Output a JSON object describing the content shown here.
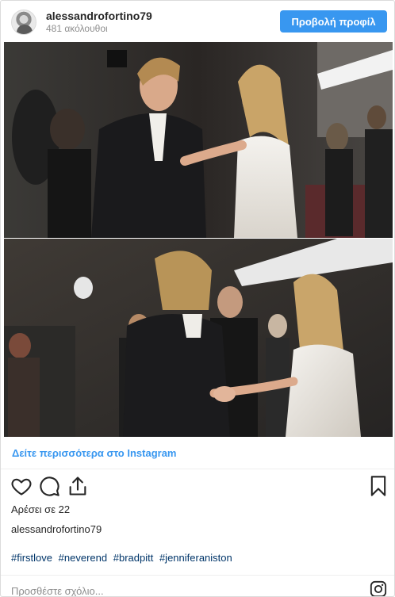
{
  "header": {
    "username": "alessandrofortino79",
    "followers": "481 ακόλουθοι",
    "profile_button": "Προβολή προφίλ"
  },
  "post": {
    "more_link": "Δείτε περισσότερα στο Instagram",
    "likes": "Αρέσει σε 22",
    "caption_user": "alessandrofortino79",
    "hashtags": [
      "#firstlove",
      "#neverend",
      "#bradpitt",
      "#jenniferaniston"
    ],
    "comment_placeholder": "Προσθέστε σχόλιο..."
  },
  "colors": {
    "accent": "#3897f0",
    "hashtag": "#003569",
    "muted": "#8e8e8e"
  },
  "icons": [
    "avatar",
    "heart-icon",
    "comment-icon",
    "share-icon",
    "bookmark-icon",
    "instagram-icon"
  ]
}
